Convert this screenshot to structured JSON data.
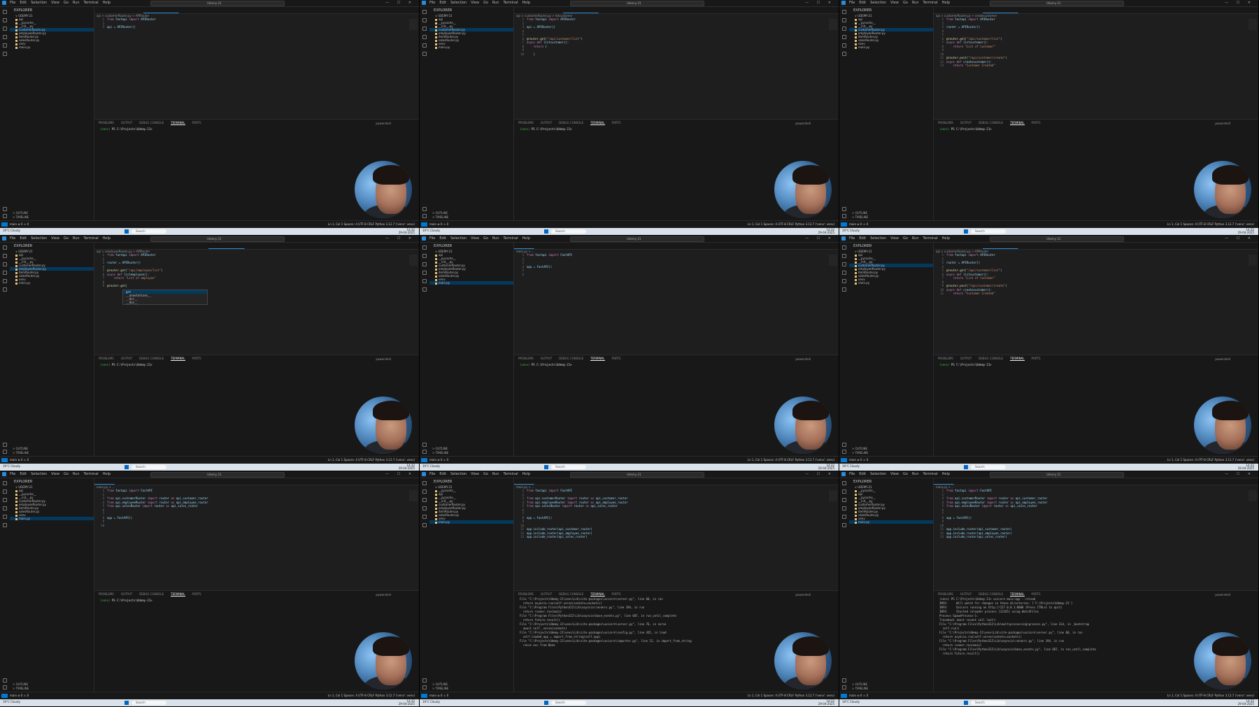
{
  "menu": [
    "File",
    "Edit",
    "Selection",
    "View",
    "Go",
    "Run",
    "Terminal",
    "Help"
  ],
  "window_title": "Udemy-21",
  "terminal_tabs": [
    "PROBLEMS",
    "OUTPUT",
    "DEBUG CONSOLE",
    "TERMINAL",
    "PORTS"
  ],
  "terminal_shell": "powershell",
  "prompt_venv": "(venv)",
  "prompt": "PS C:\\Projects\\Udemy-21>",
  "status_left": "main ⊗ 0 ⚠ 0",
  "status_right": "Ln 1, Col 1  Spaces: 4  UTF-8  CRLF  Python  3.12.7 ('venv': venv)",
  "taskbar": {
    "weather": "19°C Cloudy",
    "search": "Search",
    "time": "14:32",
    "date": "29-04-2025"
  },
  "panels": [
    {
      "explorer_title": "EXPLORER",
      "workspace": "UDEMY-21",
      "files": [
        {
          "name": "api",
          "sel": false
        },
        {
          "name": "__pycache__",
          "sel": false
        },
        {
          "name": "__init__.py",
          "sel": false
        },
        {
          "name": "customerRouter.py",
          "sel": true
        },
        {
          "name": "employeeRouter.py",
          "sel": false
        },
        {
          "name": "itemRouter.py",
          "sel": false
        },
        {
          "name": "salesRouter.py",
          "sel": false
        },
        {
          "name": "venv",
          "sel": false
        },
        {
          "name": "main.py",
          "sel": false
        }
      ],
      "tabs": [
        {
          "label": "main.py",
          "active": false
        },
        {
          "label": "itemRouter.py",
          "active": false
        },
        {
          "label": "customerRouter.py",
          "active": true
        },
        {
          "label": "salesRouter.py",
          "active": false
        },
        {
          "label": "employeeRouter.py",
          "active": false
        }
      ],
      "breadcrumb": "api > customerRouter.py > APIRouter",
      "code": [
        "from fastapi import APIRouter",
        "",
        "api = APIRouter()"
      ],
      "terminal_lines": []
    },
    {
      "explorer_title": "EXPLORER",
      "workspace": "UDEMY-21",
      "files": [
        {
          "name": "api",
          "sel": false
        },
        {
          "name": "__pycache__",
          "sel": false
        },
        {
          "name": "__init__.py",
          "sel": false
        },
        {
          "name": "customerRouter.py",
          "sel": true
        },
        {
          "name": "employeeRouter.py",
          "sel": false
        },
        {
          "name": "itemRouter.py",
          "sel": false
        },
        {
          "name": "salesRouter.py",
          "sel": false
        },
        {
          "name": "venv",
          "sel": false
        },
        {
          "name": "main.py",
          "sel": false
        }
      ],
      "tabs": [
        {
          "label": "main.py",
          "active": false
        },
        {
          "label": "itemRouter.py",
          "active": false
        },
        {
          "label": "customerRouter.py",
          "active": true
        },
        {
          "label": "salesRouter.py",
          "active": false
        },
        {
          "label": "employeeRouter.py",
          "active": false
        }
      ],
      "breadcrumb": "api > customerRouter.py > listcustomer",
      "code": [
        "from fastapi import APIRouter",
        "",
        "api = APIRouter()",
        "",
        "",
        "@router.get(\"/api/customer/list\")",
        "async def listcustomer():",
        "    return {",
        "",
        "    }"
      ],
      "terminal_lines": []
    },
    {
      "explorer_title": "EXPLORER",
      "workspace": "UDEMY-21",
      "files": [
        {
          "name": "api",
          "sel": false
        },
        {
          "name": "__pycache__",
          "sel": false
        },
        {
          "name": "__init__.py",
          "sel": false
        },
        {
          "name": "customerRouter.py",
          "sel": true
        },
        {
          "name": "employeeRouter.py",
          "sel": false
        },
        {
          "name": "itemRouter.py",
          "sel": false
        },
        {
          "name": "salesRouter.py",
          "sel": false
        },
        {
          "name": "venv",
          "sel": false
        },
        {
          "name": "main.py",
          "sel": false
        }
      ],
      "tabs": [
        {
          "label": "main.py",
          "active": false
        },
        {
          "label": "itemRouter.py",
          "active": false
        },
        {
          "label": "customerRouter.py",
          "active": true
        },
        {
          "label": "salesRouter.py",
          "active": false
        }
      ],
      "breadcrumb": "api > customerRouter.py > createcustomer",
      "code": [
        "from fastapi import APIRouter",
        "",
        "router = APIRouter()",
        "",
        "",
        "@router.get(\"/api/customer/list\")",
        "async def listcustomer():",
        "    return \"List of Customer\"",
        "",
        "",
        "@router.post(\"/api/customer/create\")",
        "async def createcustomer():",
        "    return \"Customer Created\""
      ],
      "terminal_lines": []
    },
    {
      "explorer_title": "EXPLORER",
      "workspace": "UDEMY-21",
      "files": [
        {
          "name": "api",
          "sel": false
        },
        {
          "name": "__pycache__",
          "sel": false
        },
        {
          "name": "__init__.py",
          "sel": false
        },
        {
          "name": "customerRouter.py",
          "sel": false
        },
        {
          "name": "employeeRouter.py",
          "sel": true
        },
        {
          "name": "itemRouter.py",
          "sel": false
        },
        {
          "name": "salesRouter.py",
          "sel": false
        },
        {
          "name": "venv",
          "sel": false
        },
        {
          "name": "main.py",
          "sel": false
        }
      ],
      "tabs": [
        {
          "label": "main.py",
          "active": false
        },
        {
          "label": "itemRouter.py",
          "active": false
        },
        {
          "label": "customerRouter.py",
          "active": false
        },
        {
          "label": "salesRouter.py",
          "active": false
        },
        {
          "label": "employeeRouter.py",
          "active": true
        }
      ],
      "breadcrumb": "api > employeeRouter.py > APIRouter",
      "code": [
        "from fastapi import APIRouter",
        "",
        "router = APIRouter()",
        "",
        "@router.get(\"/api/employee/list\")",
        "async def listemployee():",
        "    return \"List of employee\"",
        "",
        "@router.get|"
      ],
      "suggest": [
        "get",
        "__annotations__",
        "__dir__",
        "__doc__"
      ],
      "terminal_lines": []
    },
    {
      "explorer_title": "EXPLORER",
      "workspace": "UDEMY-21",
      "files": [
        {
          "name": "api",
          "sel": false
        },
        {
          "name": "__pycache__",
          "sel": false
        },
        {
          "name": "__init__.py",
          "sel": false
        },
        {
          "name": "customerRouter.py",
          "sel": false
        },
        {
          "name": "employeeRouter.py",
          "sel": false
        },
        {
          "name": "itemRouter.py",
          "sel": false
        },
        {
          "name": "salesRouter.py",
          "sel": false
        },
        {
          "name": "venv",
          "sel": false
        },
        {
          "name": "main.py",
          "sel": true
        }
      ],
      "tabs": [
        {
          "label": "main.py",
          "active": true
        },
        {
          "label": "itemRouter.py",
          "active": false
        },
        {
          "label": "customerRouter.py",
          "active": false
        },
        {
          "label": "salesRouter.py",
          "active": false
        },
        {
          "label": "employeeRouter.py",
          "active": false
        }
      ],
      "breadcrumb": "main.py > ...",
      "code": [
        "from fastapi import FastAPI",
        "",
        "",
        "app = FastAPI()",
        "",
        ""
      ],
      "terminal_lines": []
    },
    {
      "explorer_title": "EXPLORER",
      "workspace": "UDEMY-21",
      "files": [
        {
          "name": "api",
          "sel": false
        },
        {
          "name": "__pycache__",
          "sel": false
        },
        {
          "name": "__init__.py",
          "sel": false
        },
        {
          "name": "customerRouter.py",
          "sel": true
        },
        {
          "name": "employeeRouter.py",
          "sel": false
        },
        {
          "name": "itemRouter.py",
          "sel": false
        },
        {
          "name": "salesRouter.py",
          "sel": false
        },
        {
          "name": "venv",
          "sel": false
        },
        {
          "name": "main.py",
          "sel": false
        }
      ],
      "tabs": [
        {
          "label": "main.py",
          "active": false
        },
        {
          "label": "itemRouter.py",
          "active": false
        },
        {
          "label": "customerRouter.py",
          "active": true
        },
        {
          "label": "salesRouter.py",
          "active": false
        },
        {
          "label": "employeeRouter.py",
          "active": false
        }
      ],
      "breadcrumb": "api > customerRouter.py > APIRouter",
      "code": [
        "from fastapi import APIRouter",
        "",
        "router = APIRouter()",
        "",
        "@router.get(\"/api/customer/list\")",
        "async def listcustomer():",
        "    return \"List of Customer\"",
        "",
        "@router.post(\"/api/customer/create\")",
        "async def createcustomer():",
        "    return \"Customer Created\""
      ],
      "terminal_lines": []
    },
    {
      "explorer_title": "EXPLORER",
      "workspace": "UDEMY-21",
      "files": [
        {
          "name": "api",
          "sel": false
        },
        {
          "name": "__pycache__",
          "sel": false
        },
        {
          "name": "__init__.py",
          "sel": false
        },
        {
          "name": "customerRouter.py",
          "sel": false
        },
        {
          "name": "employeeRouter.py",
          "sel": false
        },
        {
          "name": "itemRouter.py",
          "sel": false
        },
        {
          "name": "salesRouter.py",
          "sel": false
        },
        {
          "name": "venv",
          "sel": false
        },
        {
          "name": "main.py",
          "sel": true
        }
      ],
      "tabs": [
        {
          "label": "main.py",
          "active": true
        },
        {
          "label": "itemRouter.py",
          "active": false
        },
        {
          "label": "customerRouter.py",
          "active": false
        },
        {
          "label": "salesRouter.py",
          "active": false
        },
        {
          "label": "employeeRouter.py",
          "active": false
        }
      ],
      "breadcrumb": "main.py > ...",
      "code": [
        "from fastapi import FastAPI",
        "",
        "from api.customerRouter import router as api_customer_router",
        "from api.employeeRouter import router as api_employee_router",
        "from api.salesRouter import router as api_sales_router",
        "",
        "",
        "app = FastAPI()",
        "",
        ""
      ],
      "terminal_lines": []
    },
    {
      "explorer_title": "EXPLORER",
      "workspace": "UDEMY-21",
      "files": [
        {
          "name": "__pycache__",
          "sel": false
        },
        {
          "name": "api",
          "sel": false
        },
        {
          "name": "__pycache__",
          "sel": false
        },
        {
          "name": "__init__.py",
          "sel": false
        },
        {
          "name": "customerRouter.py",
          "sel": false
        },
        {
          "name": "employeeRouter.py",
          "sel": false
        },
        {
          "name": "itemRouter.py",
          "sel": false
        },
        {
          "name": "salesRouter.py",
          "sel": false
        },
        {
          "name": "venv",
          "sel": false
        },
        {
          "name": "main.py",
          "sel": true
        }
      ],
      "tabs": [
        {
          "label": "main.py",
          "active": true
        },
        {
          "label": "itemRouter.py",
          "active": false
        },
        {
          "label": "customerRouter.py",
          "active": false
        },
        {
          "label": "salesRouter.py",
          "active": false
        },
        {
          "label": "employeeRouter.py",
          "active": false
        }
      ],
      "breadcrumb": "main.py > ...",
      "code": [
        "from fastapi import FastAPI",
        "",
        "from api.customerRouter import router as api_customer_router",
        "from api.employeeRouter import router as api_employee_router",
        "from api.salesRouter import router as api_sales_router",
        "",
        "",
        "app = FastAPI()",
        "",
        "",
        "app.include_router(api_customer_router)",
        "app.include_router(api_employee_router)",
        "app.include_router(api_sales_router)"
      ],
      "terminal_lines": [
        "File \"C:\\Projects\\Udemy-21\\venv\\Lib\\site-packages\\uvicorn\\server.py\", line 68, in run",
        "  return asyncio.run(self.serve(sockets=sockets))",
        "File \"C:\\Program Files\\Python312\\Lib\\asyncio\\runners.py\", line 194, in run",
        "  return runner.run(main)",
        "File \"C:\\Program Files\\Python312\\Lib\\asyncio\\base_events.py\", line 687, in run_until_complete",
        "  return future.result()",
        "File \"C:\\Projects\\Udemy-21\\venv\\Lib\\site-packages\\uvicorn\\server.py\", line 76, in serve",
        "  await self._serve(sockets)",
        "File \"C:\\Projects\\Udemy-21\\venv\\Lib\\site-packages\\uvicorn\\config.py\", line 435, in load",
        "  self.loaded_app = import_from_string(self.app)",
        "File \"C:\\Projects\\Udemy-21\\venv\\Lib\\site-packages\\uvicorn\\importer.py\", line 22, in import_from_string",
        "  raise exc from None"
      ]
    },
    {
      "explorer_title": "EXPLORER",
      "workspace": "UDEMY-21",
      "files": [
        {
          "name": "__pycache__",
          "sel": false
        },
        {
          "name": "api",
          "sel": false
        },
        {
          "name": "__pycache__",
          "sel": false
        },
        {
          "name": "__init__.py",
          "sel": false
        },
        {
          "name": "customerRouter.py",
          "sel": false
        },
        {
          "name": "employeeRouter.py",
          "sel": false
        },
        {
          "name": "itemRouter.py",
          "sel": false
        },
        {
          "name": "salesRouter.py",
          "sel": false
        },
        {
          "name": "venv",
          "sel": false
        },
        {
          "name": "main.py",
          "sel": true
        }
      ],
      "tabs": [
        {
          "label": "main.py",
          "active": true
        },
        {
          "label": "itemRouter.py",
          "active": false
        },
        {
          "label": "customerRouter.py",
          "active": false
        },
        {
          "label": "salesRouter.py",
          "active": false
        },
        {
          "label": "employeeRouter.py",
          "active": false
        }
      ],
      "breadcrumb": "main.py > ...",
      "code": [
        "from fastapi import FastAPI",
        "",
        "from api.customerRouter import router as api_customer_router",
        "from api.employeeRouter import router as api_employee_router",
        "from api.salesRouter import router as api_sales_router",
        "",
        "",
        "app = FastAPI()",
        "",
        "",
        "app.include_router(api_customer_router)",
        "app.include_router(api_employee_router)",
        "app.include_router(api_sales_router)"
      ],
      "terminal_lines": [
        "(venv) PS C:\\Projects\\Udemy-21> uvicorn main:app --reload",
        "INFO:     Will watch for changes in these directories: ['C:\\Projects\\Udemy-21']",
        "INFO:     Uvicorn running on http://127.0.0.1:8000 (Press CTRL+C to quit)",
        "INFO:     Started reloader process [12345] using WatchFiles",
        "Process SpawnProcess-1:",
        "Traceback (most recent call last):",
        "File \"C:\\Program Files\\Python312\\Lib\\multiprocessing\\process.py\", line 314, in _bootstrap",
        "  self.run()",
        "File \"C:\\Projects\\Udemy-21\\venv\\Lib\\site-packages\\uvicorn\\server.py\", line 68, in run",
        "  return asyncio.run(self.serve(sockets=sockets))",
        "File \"C:\\Program Files\\Python312\\Lib\\asyncio\\runners.py\", line 194, in run",
        "  return runner.run(main)",
        "File \"C:\\Program Files\\Python312\\Lib\\asyncio\\base_events.py\", line 687, in run_until_complete",
        "  return future.result()"
      ]
    }
  ]
}
